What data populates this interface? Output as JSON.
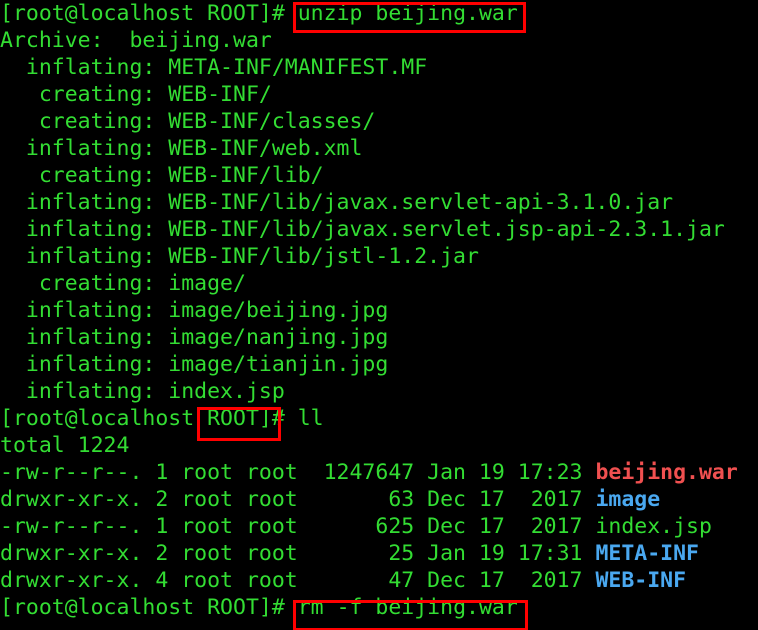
{
  "terminal": {
    "background_color": "#000000",
    "default_text_color": "#33dd33",
    "archive_color": "#f05050",
    "directory_color": "#4aa8f0",
    "highlight_color": "#ff0000",
    "prompt": "[root@localhost ROOT]#",
    "lines": [
      {
        "id": "line-1",
        "text": "[root@localhost ROOT]# unzip beijing.war"
      },
      {
        "id": "line-2",
        "text": "Archive:  beijing.war"
      },
      {
        "id": "line-3",
        "text": "  inflating: META-INF/MANIFEST.MF"
      },
      {
        "id": "line-4",
        "text": "   creating: WEB-INF/"
      },
      {
        "id": "line-5",
        "text": "   creating: WEB-INF/classes/"
      },
      {
        "id": "line-6",
        "text": "  inflating: WEB-INF/web.xml"
      },
      {
        "id": "line-7",
        "text": "   creating: WEB-INF/lib/"
      },
      {
        "id": "line-8",
        "text": "  inflating: WEB-INF/lib/javax.servlet-api-3.1.0.jar"
      },
      {
        "id": "line-9",
        "text": "  inflating: WEB-INF/lib/javax.servlet.jsp-api-2.3.1.jar"
      },
      {
        "id": "line-10",
        "text": "  inflating: WEB-INF/lib/jstl-1.2.jar"
      },
      {
        "id": "line-11",
        "text": "   creating: image/"
      },
      {
        "id": "line-12",
        "text": "  inflating: image/beijing.jpg"
      },
      {
        "id": "line-13",
        "text": "  inflating: image/nanjing.jpg"
      },
      {
        "id": "line-14",
        "text": "  inflating: image/tianjin.jpg"
      },
      {
        "id": "line-15",
        "text": "  inflating: index.jsp"
      },
      {
        "id": "line-16",
        "text": "[root@localhost ROOT]# ll"
      },
      {
        "id": "line-17",
        "text": "total 1224"
      },
      {
        "id": "line-22",
        "text": "[root@localhost ROOT]# rm -f beijing.war"
      }
    ],
    "listing": {
      "total_label": "total 1224",
      "command": "ll",
      "rows": [
        {
          "permissions": "-rw-r--r--.",
          "links": "1",
          "owner": "root",
          "group": "root",
          "size": "1247647",
          "month": "Jan",
          "day": "19",
          "time": "17:23",
          "name": "beijing.war",
          "type": "archive"
        },
        {
          "permissions": "drwxr-xr-x.",
          "links": "2",
          "owner": "root",
          "group": "root",
          "size": "63",
          "month": "Dec",
          "day": "17",
          "time": "2017",
          "name": "image",
          "type": "directory"
        },
        {
          "permissions": "-rw-r--r--.",
          "links": "1",
          "owner": "root",
          "group": "root",
          "size": "625",
          "month": "Dec",
          "day": "17",
          "time": "2017",
          "name": "index.jsp",
          "type": "file"
        },
        {
          "permissions": "drwxr-xr-x.",
          "links": "2",
          "owner": "root",
          "group": "root",
          "size": "25",
          "month": "Jan",
          "day": "19",
          "time": "17:31",
          "name": "META-INF",
          "type": "directory"
        },
        {
          "permissions": "drwxr-xr-x.",
          "links": "4",
          "owner": "root",
          "group": "root",
          "size": "47",
          "month": "Dec",
          "day": "17",
          "time": "2017",
          "name": "WEB-INF",
          "type": "directory"
        }
      ]
    },
    "commands": {
      "unzip": "unzip beijing.war",
      "list": "ll",
      "remove": "rm -f beijing.war"
    },
    "highlights": [
      {
        "id": "hl-unzip-command",
        "label": "unzip beijing.war"
      },
      {
        "id": "hl-root-prompt",
        "label": "ROOT]"
      },
      {
        "id": "hl-remove-command",
        "label": "rm -f beijing.war"
      }
    ]
  }
}
